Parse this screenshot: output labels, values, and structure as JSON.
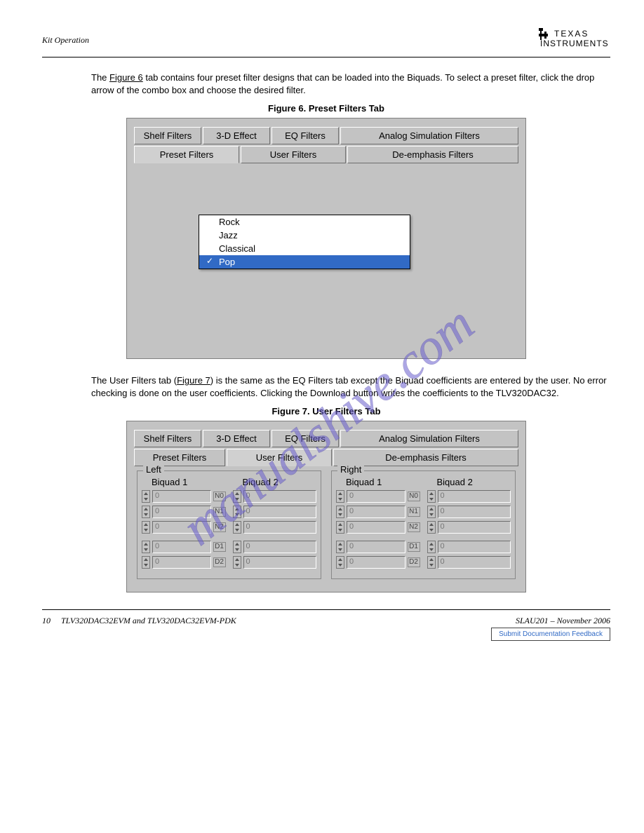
{
  "header": {
    "section_title": "Kit Operation",
    "brand_line1": "TEXAS",
    "brand_line2": "INSTRUMENTS"
  },
  "para1_a": "The ",
  "para1_b": " tab contains four preset filter designs that can be loaded into the Biquads. To select a preset filter, click the drop arrow of the combo box and choose the desired filter.",
  "para2_a": "The User Filters tab (",
  "para2_b": ") is the same as the EQ Filters tab except the Biquad coefficients are entered by the user. No error checking is done on the user coefficients. Clicking the Download button writes the coefficients to the TLV320DAC32.",
  "fig6": {
    "ref": "Figure 6",
    "caption": "Figure 6. Preset Filters Tab"
  },
  "fig7": {
    "ref": "Figure 7",
    "caption": "Figure 7. User Filters Tab"
  },
  "tabs_top": [
    "Shelf Filters",
    "3-D Effect",
    "EQ Filters",
    "Analog Simulation Filters"
  ],
  "tabs_bot": [
    "Preset Filters",
    "User Filters",
    "De-emphasis Filters"
  ],
  "preset_menu": {
    "items": [
      "Rock",
      "Jazz",
      "Classical",
      "Pop"
    ],
    "selected": "Pop"
  },
  "groups": {
    "left": "Left",
    "right": "Right",
    "biquad1": "Biquad 1",
    "biquad2": "Biquad 2",
    "coef_labels": [
      "N0",
      "N1",
      "N2",
      "D1",
      "D2"
    ],
    "zero": "0"
  },
  "footer": {
    "page": "10",
    "doc": "TLV320DAC32EVM and TLV320DAC32EVM-PDK",
    "rev": "SLAU201 – November 2006",
    "feedback": "Submit Documentation Feedback"
  }
}
